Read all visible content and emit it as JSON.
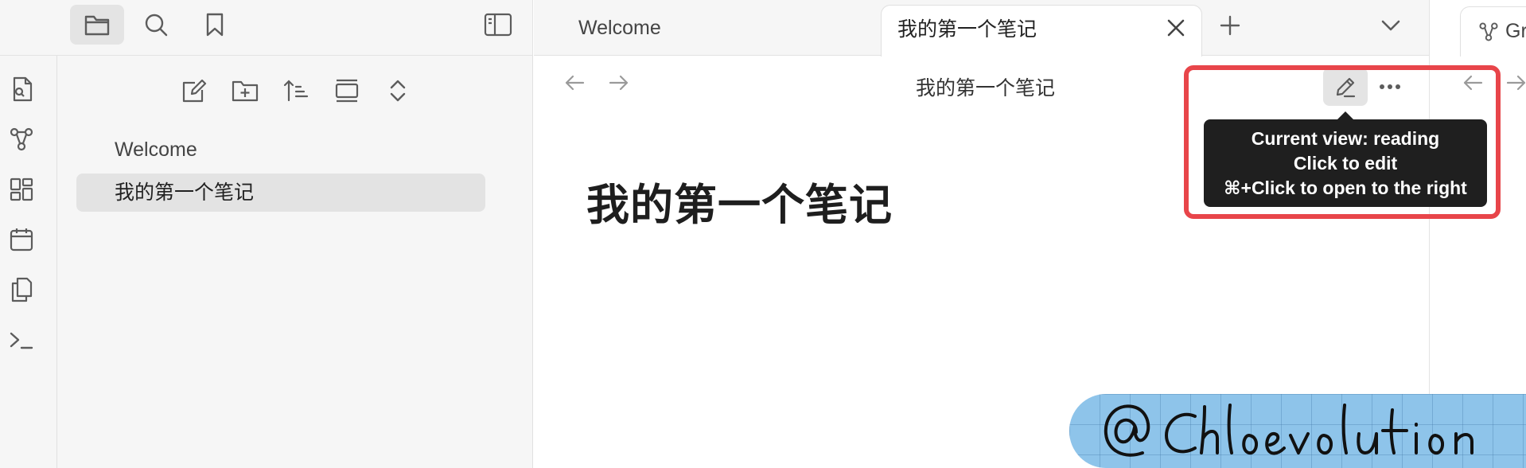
{
  "tabs": {
    "welcome": "Welcome",
    "active": "我的第一个笔记",
    "right_partial": "Gr"
  },
  "explorer": {
    "items": [
      {
        "label": "Welcome"
      },
      {
        "label": "我的第一个笔记"
      }
    ]
  },
  "view": {
    "title": "我的第一个笔记",
    "heading": "我的第一个笔记"
  },
  "tooltip": {
    "line1": "Current view: reading",
    "line2": "Click to edit",
    "line3": "⌘+Click to open to the right"
  },
  "watermark": "@ Chloevolution",
  "colors": {
    "highlight": "#e8454a",
    "tooltip_bg": "#1f1f1f",
    "watermark_bg": "#8ec4ea"
  },
  "icons": {
    "topbar": [
      "folder-icon",
      "search-icon",
      "bookmark-icon",
      "sidebar-toggle-icon"
    ],
    "ribbon": [
      "quick-switch-icon",
      "graph-icon",
      "canvas-icon",
      "calendar-icon",
      "templates-icon",
      "terminal-icon"
    ],
    "explorer_nav": [
      "new-note-icon",
      "new-folder-icon",
      "sort-icon",
      "collapse-icon",
      "expand-icon"
    ]
  }
}
